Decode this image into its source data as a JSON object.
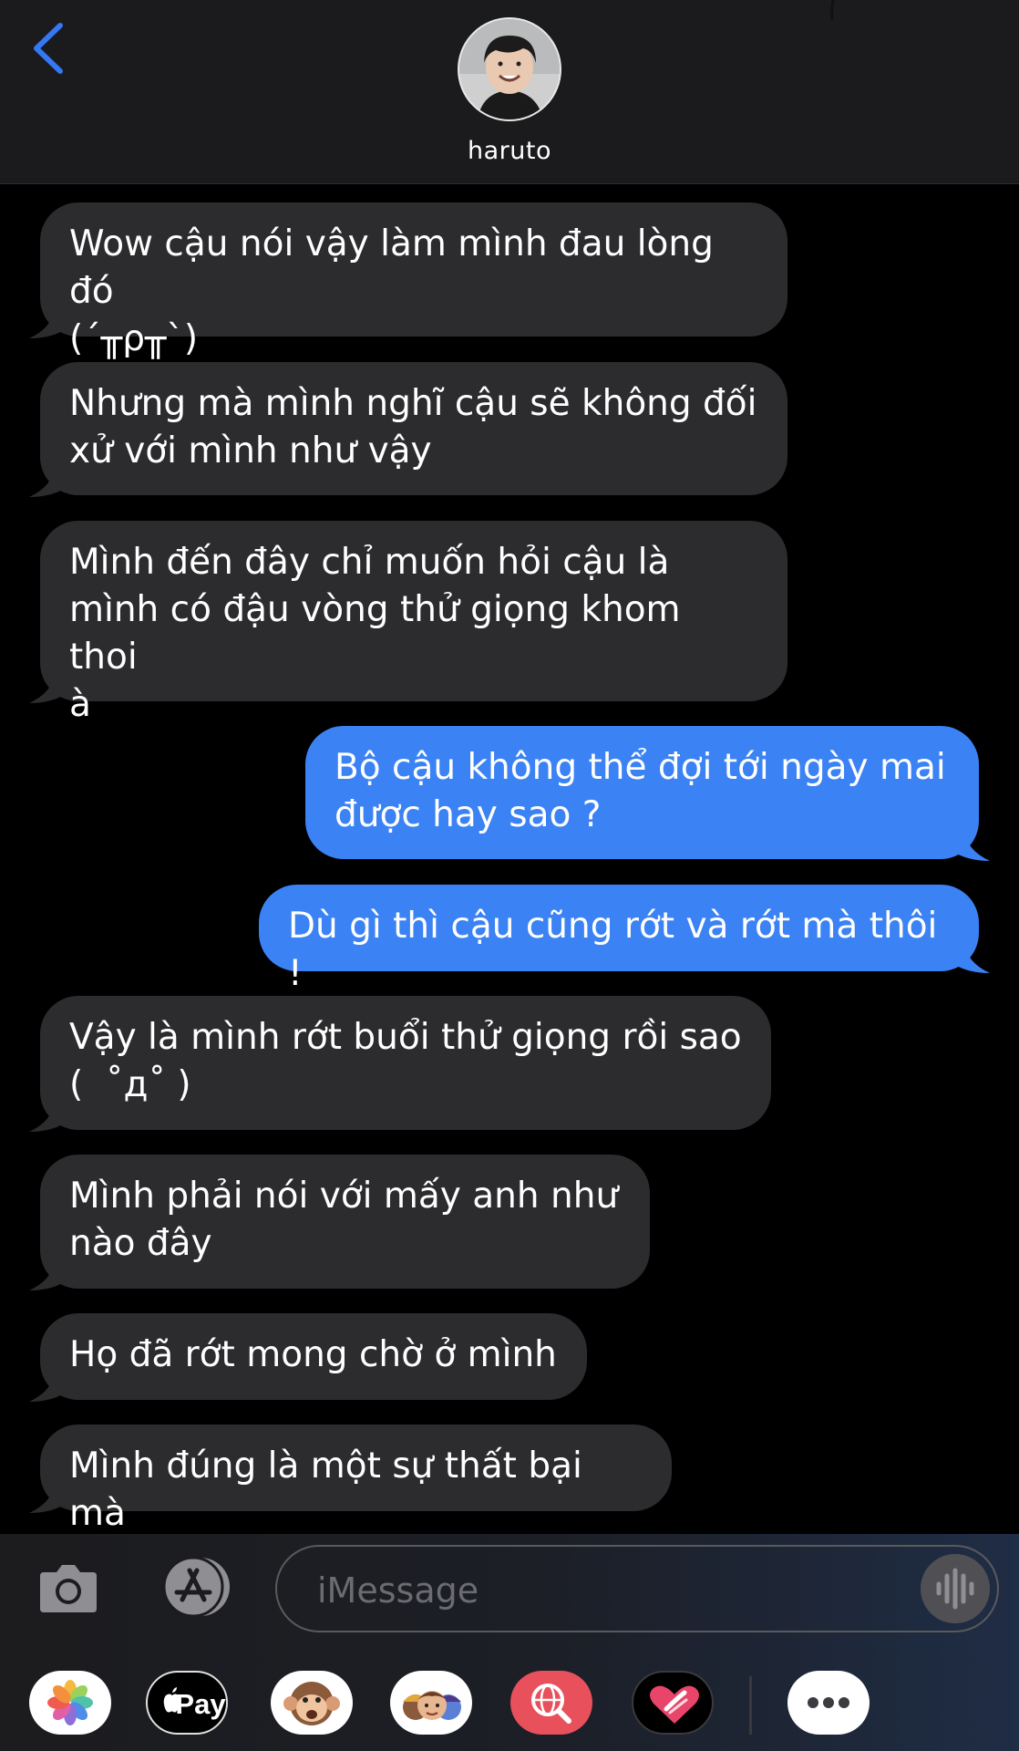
{
  "header": {
    "back_icon": "chevron-left-icon",
    "contact_name": "haruto"
  },
  "messages": [
    {
      "direction": "incoming",
      "text": "Wow cậu nói vậy làm mình đau lòng đó\n(´╥ρ╥`)"
    },
    {
      "direction": "incoming",
      "text": "Nhưng mà mình nghĩ cậu sẽ không đối\nxử với mình như vậy"
    },
    {
      "direction": "incoming",
      "text": "Mình đến đây chỉ muốn hỏi cậu là\nmình có đậu vòng thử giọng khom thoi\nà"
    },
    {
      "direction": "outgoing",
      "text": "Bộ cậu không thể đợi tới ngày mai\nđược hay sao ?"
    },
    {
      "direction": "outgoing",
      "text": "Dù gì thì cậu cũng rớt và rớt mà thôi !"
    },
    {
      "direction": "incoming",
      "text": "Vậy là mình rớt buổi thử giọng rồi sao\n(  ˚д˚ )"
    },
    {
      "direction": "incoming",
      "text": "Mình phải nói với mấy anh như\nnào đây"
    },
    {
      "direction": "incoming",
      "text": "Họ đã rớt mong chờ ở mình"
    },
    {
      "direction": "incoming",
      "text": "Mình đúng là một sự thất bại mà"
    }
  ],
  "composer": {
    "camera_icon": "camera-icon",
    "appstore_icon": "app-store-icon",
    "placeholder": "iMessage",
    "voice_icon": "waveform-icon"
  },
  "app_drawer": {
    "items": [
      "photos",
      "apple-pay",
      "animoji",
      "memoji",
      "image-search",
      "digital-touch",
      "more"
    ],
    "pay_label": "Pay"
  },
  "colors": {
    "incoming_bubble": "#2c2c2e",
    "outgoing_bubble": "#3b82f4",
    "accent": "#3478f6"
  }
}
